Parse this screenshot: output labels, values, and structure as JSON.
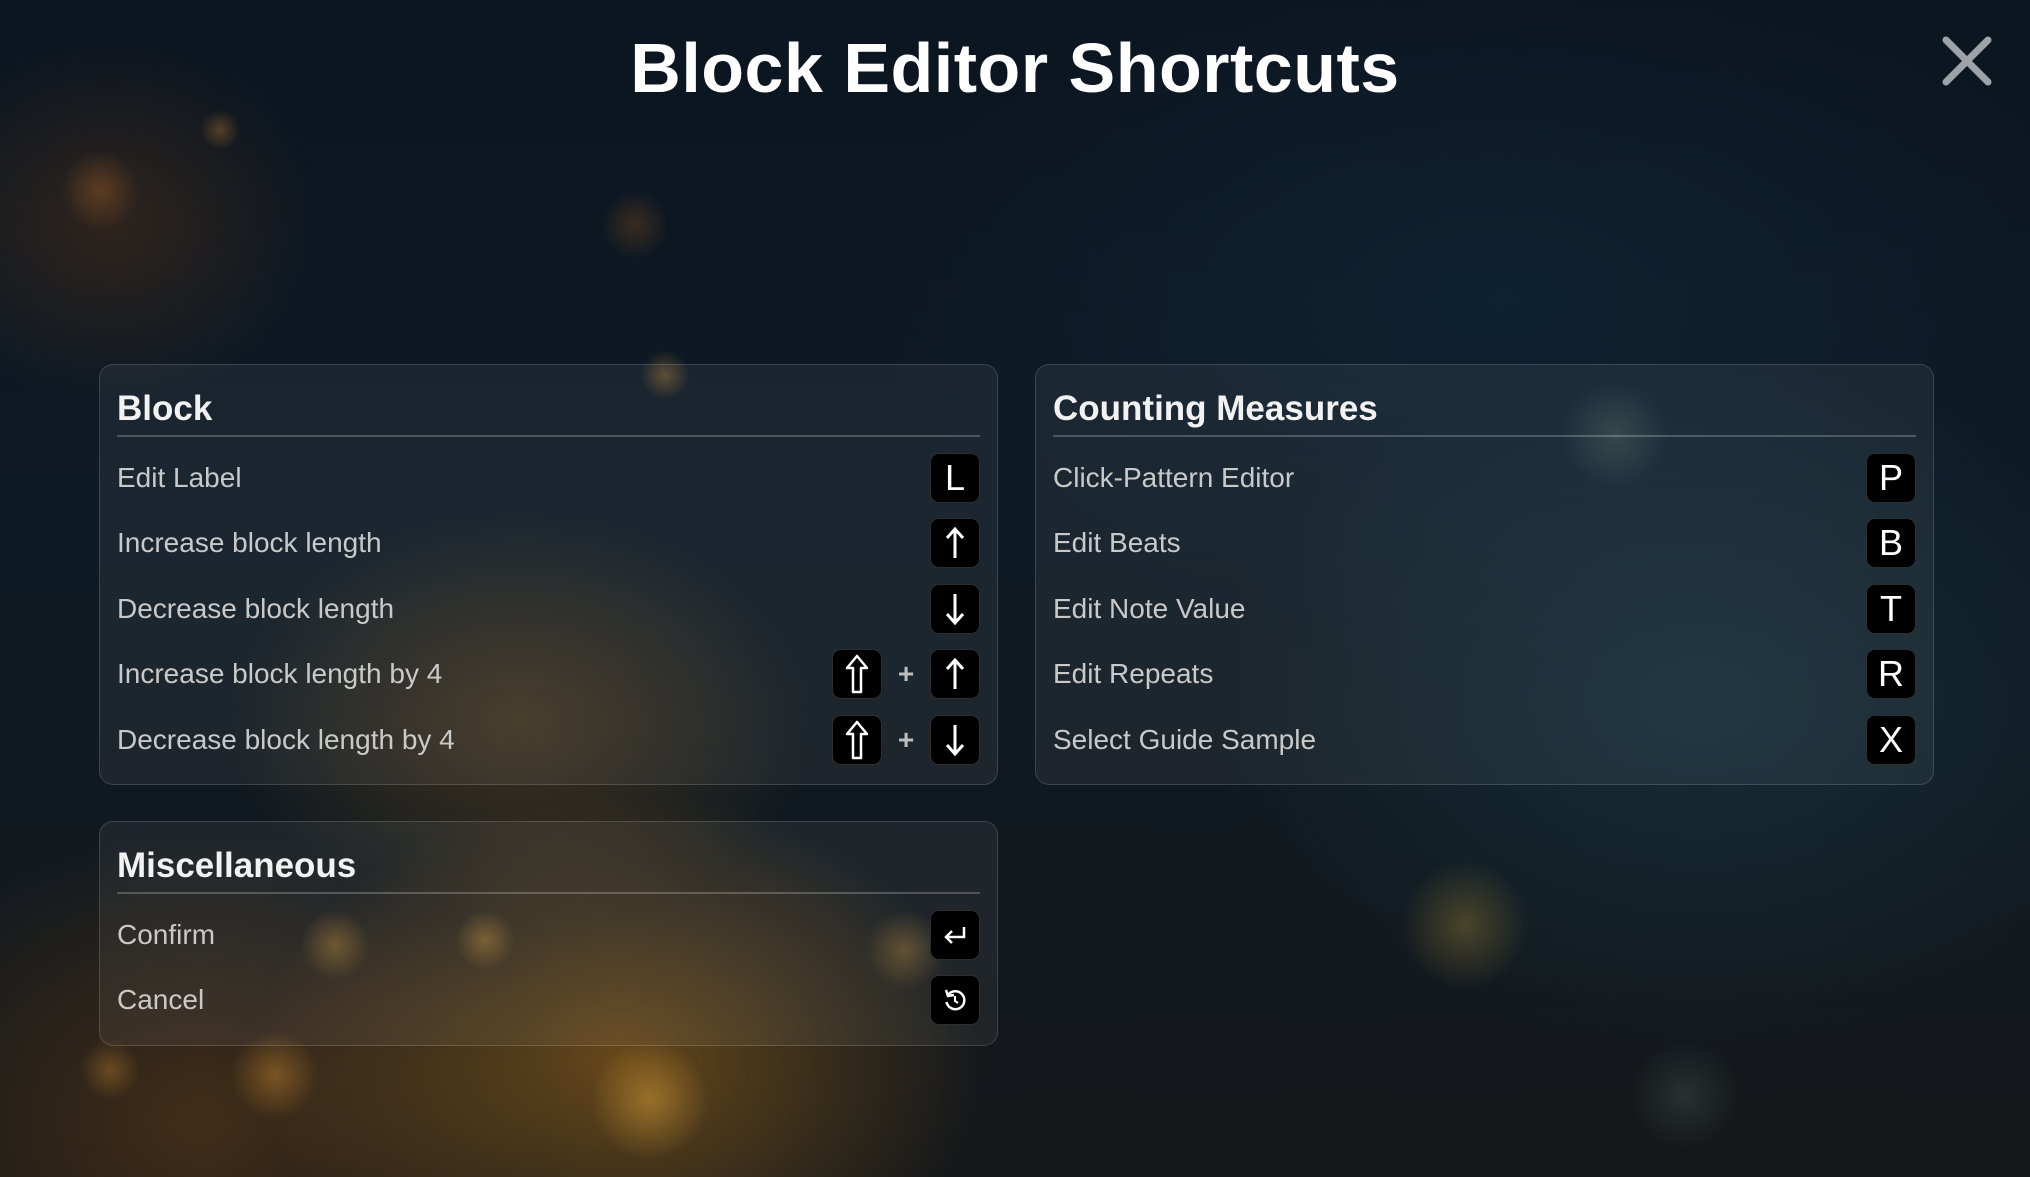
{
  "title": "Block Editor Shortcuts",
  "close_icon": "close-icon",
  "colors": {
    "panel_background": "rgba(255,255,255,0.055)",
    "key_background": "#000000",
    "label_text": "#c9c9c9",
    "heading_text": "#ffffff"
  },
  "sections": {
    "block": {
      "title": "Block",
      "rows": [
        {
          "label": "Edit Label",
          "keys": [
            "L"
          ]
        },
        {
          "label": "Increase block length",
          "keys": [
            "arrow-up-icon"
          ]
        },
        {
          "label": "Decrease block length",
          "keys": [
            "arrow-down-icon"
          ]
        },
        {
          "label": "Increase block length by 4",
          "keys": [
            "shift-icon",
            "arrow-up-icon"
          ],
          "joiner": "+"
        },
        {
          "label": "Decrease block length by 4",
          "keys": [
            "shift-icon",
            "arrow-down-icon"
          ],
          "joiner": "+"
        }
      ]
    },
    "counting": {
      "title": "Counting Measures",
      "rows": [
        {
          "label": "Click-Pattern Editor",
          "keys": [
            "P"
          ]
        },
        {
          "label": "Edit Beats",
          "keys": [
            "B"
          ]
        },
        {
          "label": "Edit Note Value",
          "keys": [
            "T"
          ]
        },
        {
          "label": "Edit Repeats",
          "keys": [
            "R"
          ]
        },
        {
          "label": "Select Guide Sample",
          "keys": [
            "X"
          ]
        }
      ]
    },
    "misc": {
      "title": "Miscellaneous",
      "rows": [
        {
          "label": "Confirm",
          "keys": [
            "enter-icon"
          ]
        },
        {
          "label": "Cancel",
          "keys": [
            "undo-icon"
          ]
        }
      ]
    }
  }
}
